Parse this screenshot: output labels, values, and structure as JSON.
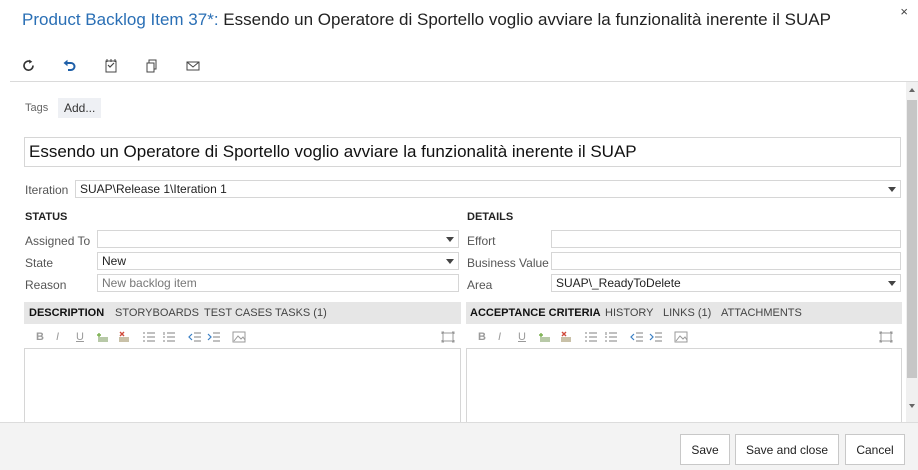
{
  "header": {
    "kind": "Product Backlog Item 37*:",
    "title": "Essendo un Operatore di Sportello voglio avviare la funzionalità inerente il SUAP",
    "close_glyph": "×"
  },
  "toolbar": {
    "icons": [
      "refresh-icon",
      "undo-icon",
      "save-notes-icon",
      "copy-icon",
      "email-icon"
    ]
  },
  "tags": {
    "label": "Tags",
    "add_label": "Add..."
  },
  "work_item_title": "Essendo un Operatore di Sportello voglio avviare la funzionalità inerente il SUAP",
  "iteration": {
    "label": "Iteration",
    "value": "SUAP\\Release 1\\Iteration 1"
  },
  "status": {
    "heading": "STATUS",
    "assigned_to": {
      "label": "Assigned To",
      "value": ""
    },
    "state": {
      "label": "State",
      "value": "New"
    },
    "reason": {
      "label": "Reason",
      "value": "New backlog item"
    }
  },
  "details": {
    "heading": "DETAILS",
    "effort": {
      "label": "Effort",
      "value": ""
    },
    "business_value": {
      "label": "Business Value",
      "value": ""
    },
    "area": {
      "label": "Area",
      "value": "SUAP\\_ReadyToDelete"
    }
  },
  "left_tabs": [
    "DESCRIPTION",
    "STORYBOARDS",
    "TEST CASES",
    "TASKS (1)"
  ],
  "right_tabs": [
    "ACCEPTANCE CRITERIA",
    "HISTORY",
    "LINKS (1)",
    "ATTACHMENTS"
  ],
  "rte": {
    "bold": "B",
    "italic": "I",
    "underline": "U"
  },
  "footer": {
    "save": "Save",
    "save_close": "Save and close",
    "cancel": "Cancel"
  },
  "colors": {
    "accent": "#2a6fb5",
    "tab_bg": "#e6e6e6",
    "footer_bg": "#f3f3f3"
  }
}
